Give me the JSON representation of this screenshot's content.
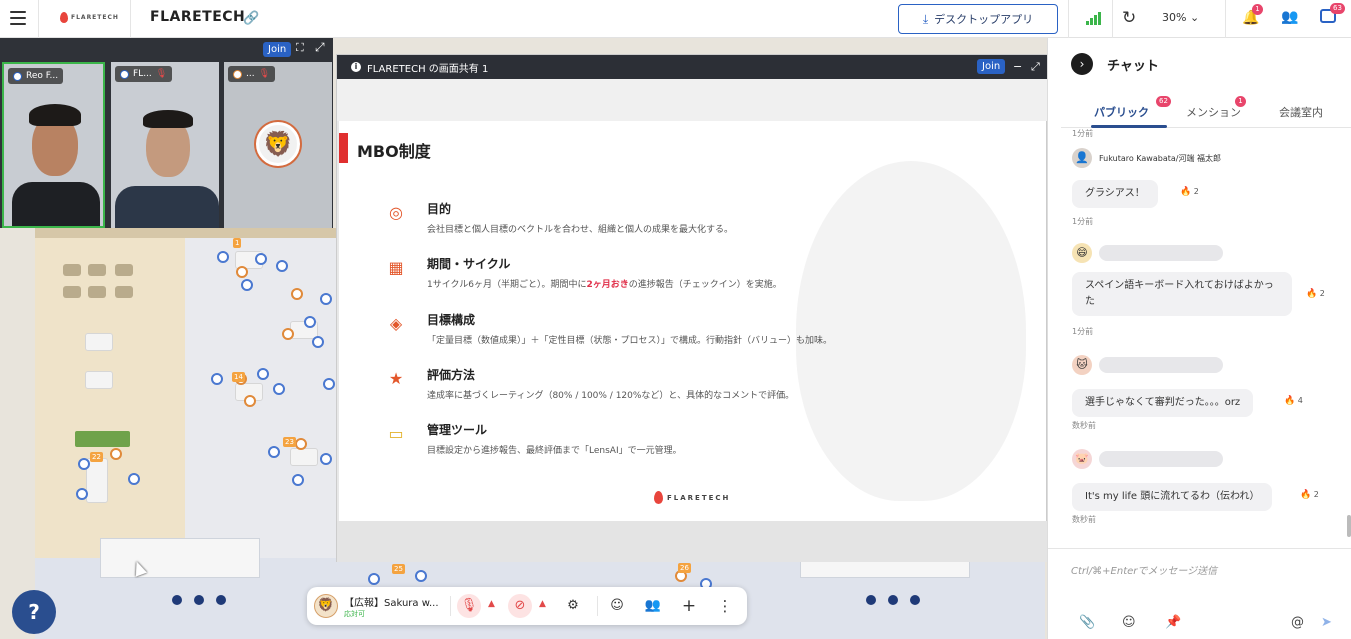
{
  "topbar": {
    "logo_text": "FLARETECH",
    "space_title": "FLARETECH",
    "desktop_app_label": "デスクトップアプリ",
    "zoom": "30%",
    "notification_count": "1",
    "chat_count": "63"
  },
  "video_strip": {
    "join_label": "Join",
    "tiles": [
      {
        "name": "Reo F..."
      },
      {
        "name": "FL..."
      },
      {
        "name": "..."
      }
    ]
  },
  "screenshare": {
    "title": "FLARETECH の画面共有 1",
    "join_label": "Join",
    "slide": {
      "title": "MBO制度",
      "sections": [
        {
          "icon": "target-icon",
          "heading": "目的",
          "desc": "会社目標と個人目標のベクトルを合わせ、組織と個人の成果を最大化する。"
        },
        {
          "icon": "calendar-icon",
          "heading": "期間・サイクル",
          "desc_pre": "1サイクル6ヶ月（半期ごと）。期間中に",
          "desc_red": "2ヶ月おき",
          "desc_post": "の進捗報告（チェックイン）を実施。"
        },
        {
          "icon": "layers-icon",
          "heading": "目標構成",
          "desc": "「定量目標（数値成果）」＋「定性目標（状態・プロセス）」で構成。行動指針（バリュー）も加味。"
        },
        {
          "icon": "star-icon",
          "heading": "評価方法",
          "desc": "達成率に基づくレーティング（80% / 100% / 120%など）と、具体的なコメントで評価。"
        },
        {
          "icon": "laptop-icon",
          "heading": "管理ツール",
          "desc": "目標設定から進捗報告、最終評価まで「LensAI」で一元管理。"
        }
      ],
      "logo_text": "FLARETECH"
    }
  },
  "controls": {
    "user_name": "【広報】Sakura w...",
    "user_status": "応対可"
  },
  "map_labels": {
    "room_numbers": [
      "1",
      "14",
      "22",
      "23",
      "25",
      "26"
    ]
  },
  "chat": {
    "title": "チャット",
    "tabs": [
      {
        "label": "パブリック",
        "badge": "62"
      },
      {
        "label": "メンション",
        "badge": "1"
      },
      {
        "label": "会議室内",
        "badge": ""
      }
    ],
    "messages": [
      {
        "ts_above": "1分前"
      },
      {
        "sender": "Fukutaro Kawabata/河端 福太郎",
        "text": "グラシアス！",
        "reactions": "2",
        "ts": "1分前"
      },
      {
        "text": "スペイン語キーボード入れておけばよかった",
        "reactions": "2",
        "ts": "1分前"
      },
      {
        "text": "選手じゃなくて審判だった。。。orz",
        "reactions": "4",
        "ts": "数秒前"
      },
      {
        "text": "It's my life 頭に流れてるわ（伝われ）",
        "reactions": "2",
        "ts": "数秒前"
      }
    ],
    "input_placeholder": "Ctrl/⌘+Enterでメッセージ送信"
  }
}
